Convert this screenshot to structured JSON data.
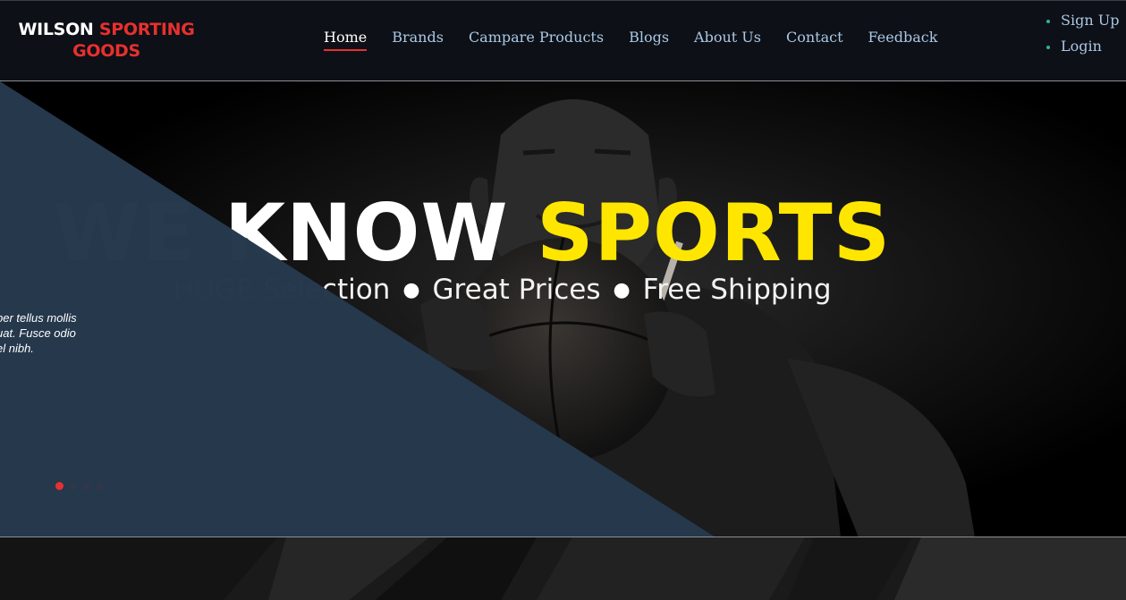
{
  "brand": {
    "line1_white": "WILSON",
    "line1_red": "SPORTING",
    "line2_red": "GOODS"
  },
  "nav": {
    "items": [
      {
        "label": "Home",
        "active": true
      },
      {
        "label": "Brands"
      },
      {
        "label": "Campare Products"
      },
      {
        "label": "Blogs"
      },
      {
        "label": "About Us"
      },
      {
        "label": "Contact"
      },
      {
        "label": "Feedback"
      }
    ]
  },
  "account": {
    "signup": "Sign Up",
    "login": "Login"
  },
  "hero": {
    "headline_white": "WE KNOW",
    "headline_yellow": "SPORTS",
    "subline": [
      "HUGE Selection",
      "Great Prices",
      "Free Shipping"
    ],
    "separator": "●",
    "panel_text_lines": [
      "per tellus mollis",
      "uat. Fusce odio",
      "el nibh."
    ],
    "slide_count": 4,
    "active_slide": 1
  },
  "colors": {
    "accent_red": "#e8302e",
    "accent_yellow": "#ffe600",
    "nav_text": "#aac8e6",
    "panel": "#26384d"
  }
}
